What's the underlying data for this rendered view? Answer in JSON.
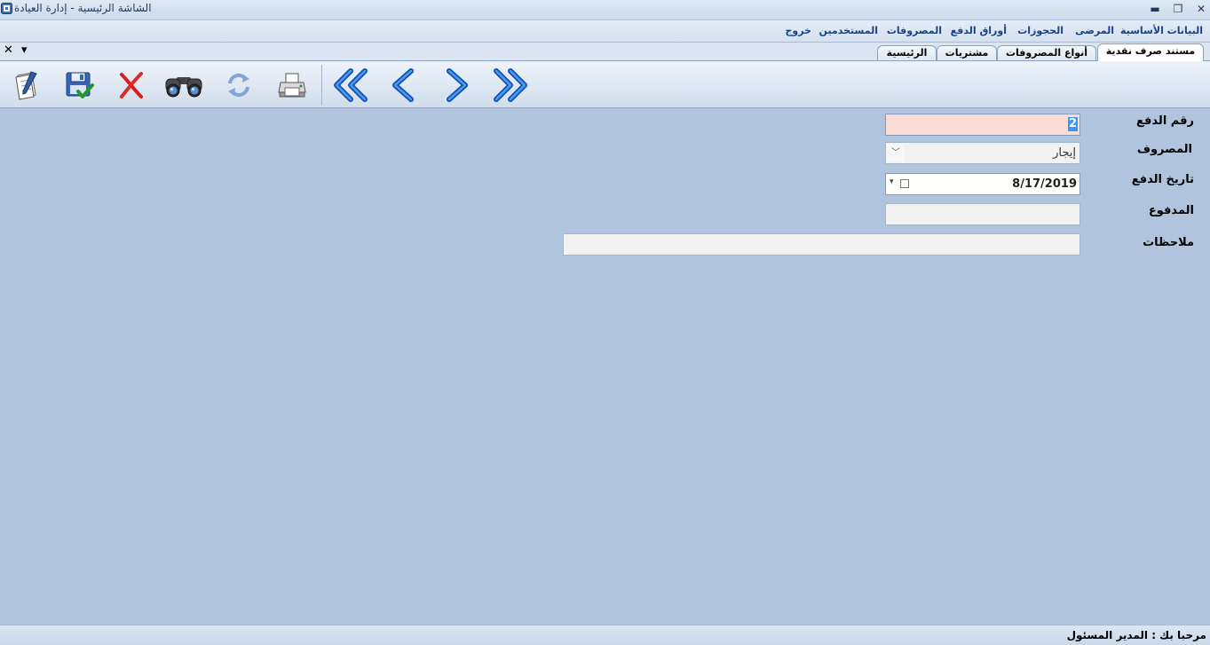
{
  "window": {
    "title": "الشاشة الرئيسية - إدارة العيادة",
    "controls": {
      "minimize": "▬",
      "restore": "❐",
      "close": "✕"
    }
  },
  "menu": {
    "items": [
      {
        "label": "البيانات الأساسية"
      },
      {
        "label": "المرضى"
      },
      {
        "label": "الحجوزات"
      },
      {
        "label": "أوراق الدفع"
      },
      {
        "label": "المصروفات"
      },
      {
        "label": "المستخدمين"
      },
      {
        "label": "خروج"
      }
    ]
  },
  "tabbar": {
    "close_glyph": "✕",
    "dropdown_glyph": "▾",
    "tabs": [
      {
        "label": "مستند صرف نقدية",
        "active": true
      },
      {
        "label": "أنواع المصروفات",
        "active": false
      },
      {
        "label": "مشتريات",
        "active": false
      },
      {
        "label": "الرئيسية",
        "active": false
      }
    ]
  },
  "toolbar": {
    "tools": [
      {
        "icon": "new-document-icon"
      },
      {
        "icon": "save-icon"
      },
      {
        "icon": "delete-icon"
      },
      {
        "icon": "search-binoculars-icon"
      },
      {
        "icon": "refresh-icon"
      },
      {
        "icon": "print-icon"
      },
      {
        "icon": "first-record-icon"
      },
      {
        "icon": "previous-record-icon"
      },
      {
        "icon": "next-record-icon"
      },
      {
        "icon": "last-record-icon"
      }
    ]
  },
  "form": {
    "payment_number": {
      "label": "رقم الدفع",
      "value": "2"
    },
    "expense": {
      "label": "المصروف",
      "value": "إيجار",
      "arrow": "﹀"
    },
    "payment_date": {
      "label": "تاريخ الدفع",
      "value": "8/17/2019",
      "arrow": "▾"
    },
    "paid": {
      "label": "المدفوع",
      "value": ""
    },
    "notes": {
      "label": "ملاحظات",
      "value": ""
    }
  },
  "status": {
    "text": "مرحبا بك :  المدير المسئول"
  },
  "colors": {
    "background": "#b0c4de",
    "menu_text": "#15428b",
    "required_field": "#fcdcd6",
    "selection": "#3399ff",
    "nav_blue": "#1f6fd1"
  }
}
